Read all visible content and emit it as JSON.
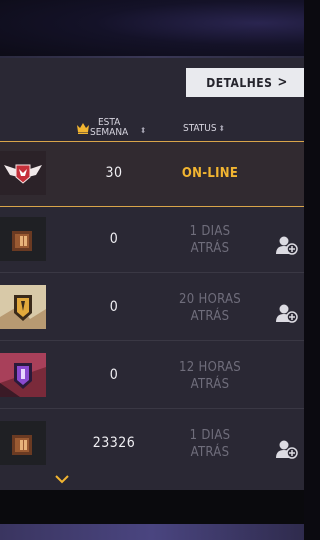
{
  "header": {
    "details_label": "DETALHES",
    "week_line1": "ESTA",
    "week_line2": "SEMANA",
    "status_label": "STATUS",
    "sort_glyph": "⬍"
  },
  "rows": [
    {
      "score": "30",
      "status_line1": "ON-LINE",
      "status_line2": "",
      "badge": "winged-shield-badge-icon"
    },
    {
      "score": "0",
      "status_line1": "1 DIAS",
      "status_line2": "ATRÁS",
      "badge": "bronze-rank-badge-icon"
    },
    {
      "score": "0",
      "status_line1": "20 HORAS",
      "status_line2": "ATRÁS",
      "badge": "gold-rank-badge-icon"
    },
    {
      "score": "0",
      "status_line1": "12 HORAS",
      "status_line2": "ATRÁS",
      "badge": "purple-rank-badge-icon"
    },
    {
      "score": "23326",
      "status_line1": "1 DIAS",
      "status_line2": "ATRÁS",
      "badge": "bronze-rank-badge-icon"
    }
  ],
  "colors": {
    "online": "#f2b531",
    "offline": "#6f6d7b",
    "highlight_border": "#d9a54a",
    "panel": "#2a2834"
  }
}
